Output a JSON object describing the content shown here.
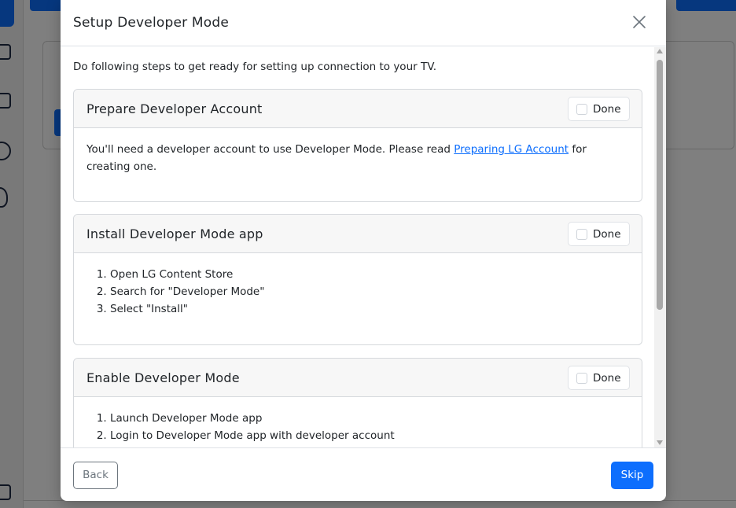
{
  "modal": {
    "title": "Setup Developer Mode",
    "intro": "Do following steps to get ready for setting up connection to your TV.",
    "done_label": "Done",
    "steps": [
      {
        "title": "Prepare Developer Account",
        "text_before": "You'll need a developer account to use Developer Mode. Please read ",
        "link_text": "Preparing LG Account",
        "text_after": " for creating one."
      },
      {
        "title": "Install Developer Mode app",
        "items": [
          "Open LG Content Store",
          "Search for \"Developer Mode\"",
          "Select \"Install\""
        ]
      },
      {
        "title": "Enable Developer Mode",
        "items": [
          "Launch Developer Mode app",
          "Login to Developer Mode app with developer account"
        ]
      }
    ],
    "footer": {
      "back_label": "Back",
      "skip_label": "Skip"
    }
  },
  "colors": {
    "primary": "#0d6efd",
    "secondary": "#6c757d",
    "backdrop": "rgba(0,0,0,0.5)"
  },
  "icons": {
    "close": "close-icon"
  }
}
